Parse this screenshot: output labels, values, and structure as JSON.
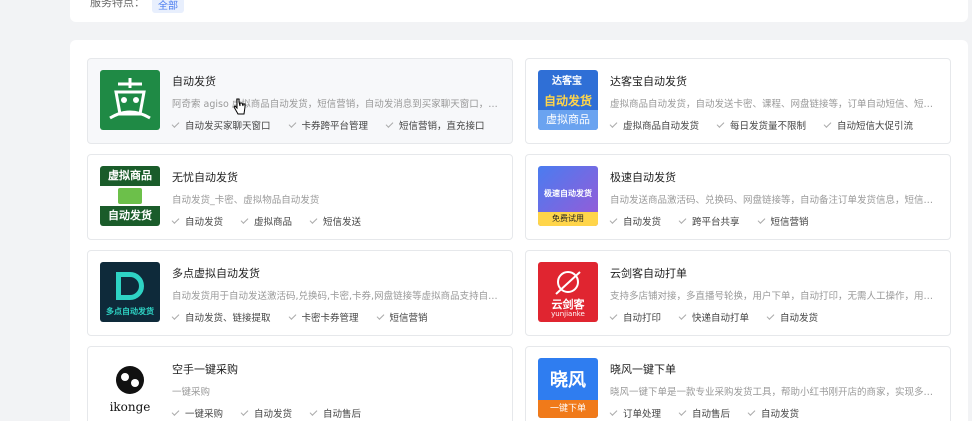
{
  "top": {
    "label": "服务特点：",
    "tag": "全部"
  },
  "cards": [
    {
      "title": "自动发货",
      "desc": "阿奇索 agiso 虚拟商品自动发货，短信营销，自动发消息到买家聊天窗口，对接…",
      "features": [
        "自动发买家聊天窗口",
        "卡券跨平台管理",
        "短信营销，直充接口"
      ],
      "logo": "agiso-logo"
    },
    {
      "title": "达客宝自动发货",
      "desc": "虚拟商品自动发货，自动发送卡密、课程、网盘链接等，订单自动短信、短信群…",
      "features": [
        "虚拟商品自动发货",
        "每日发货量不限制",
        "自动短信大促引流"
      ],
      "logo": "dakebao-logo"
    },
    {
      "title": "无忧自动发货",
      "desc": "自动发货_卡密、虚拟物品自动发货",
      "features": [
        "自动发货",
        "虚拟商品",
        "短信发送"
      ],
      "logo": "wuyou-logo"
    },
    {
      "title": "极速自动发货",
      "desc": "自动发送商品激活码、兑换码、网盘链接等，自动备注订单发货信息，短信营销…",
      "features": [
        "自动发货",
        "跨平台共享",
        "短信营销"
      ],
      "logo": "jisu-logo"
    },
    {
      "title": "多点虚拟自动发货",
      "desc": "自动发货用于自动发送激活码,兑换码,卡密,卡券,网盘链接等虚拟商品支持自助提…",
      "features": [
        "自动发货、链接提取",
        "卡密卡券管理",
        "短信营销"
      ],
      "logo": "duodian-logo"
    },
    {
      "title": "云剑客自动打单",
      "desc": "支持多店铺对接，多直播号轮换，用户下单，自动打印，无需人工操作，用户显…",
      "features": [
        "自动打印",
        "快递自动打单",
        "自动发货"
      ],
      "logo": "yunjianke-logo"
    },
    {
      "title": "空手一键采购",
      "desc": "一键采购",
      "features": [
        "一键采购",
        "自动发货",
        "自动售后"
      ],
      "logo": "ikonge-logo"
    },
    {
      "title": "晓风一键下单",
      "desc": "晓风一键下单是一款专业采购发货工具，帮助小红书刚开店的商家，实现多店铺…",
      "features": [
        "订单处理",
        "自动售后",
        "自动发货"
      ],
      "logo": "xiaofeng-logo"
    }
  ],
  "logo_text": {
    "dakebao_top": "达客宝",
    "dakebao_mid": "自动发货",
    "dakebao_bot": "虚拟商品",
    "wuyou_top": "虚拟商品",
    "wuyou_bot": "自动发货",
    "jisu_mid": "极速自动发货",
    "jisu_bot": "免费试用",
    "duodian": "多点自动发货",
    "yunjianke_cn": "云剑客",
    "yunjianke_en": "yunjianke",
    "ikonge": "ikonge",
    "xiaofeng_main": "晓风",
    "xiaofeng_sub": "一键下单"
  },
  "colors": {
    "agiso_green": "#1f8a45",
    "blue": "#2f6fd6",
    "red": "#e02530",
    "dark_green": "#1a5c2a"
  }
}
